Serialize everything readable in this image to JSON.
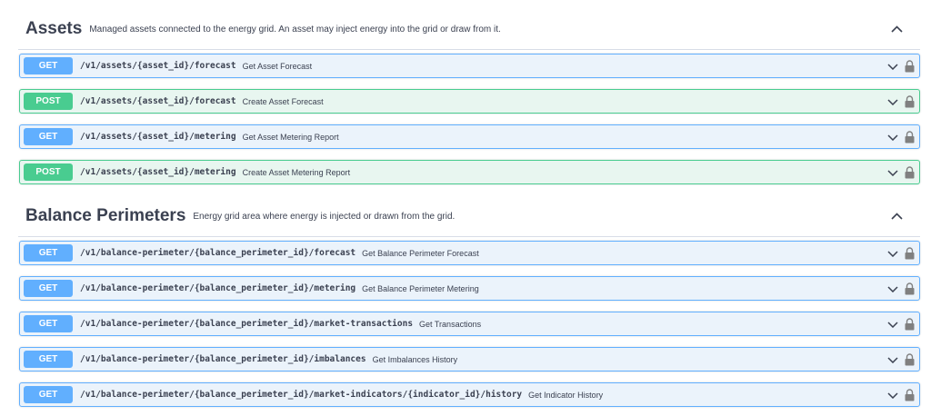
{
  "sections": [
    {
      "title": "Assets",
      "description": "Managed assets connected to the energy grid. An asset may inject energy into the grid or draw from it.",
      "operations": [
        {
          "method": "GET",
          "path": "/v1/assets/{asset_id}/forecast",
          "summary": "Get Asset Forecast"
        },
        {
          "method": "POST",
          "path": "/v1/assets/{asset_id}/forecast",
          "summary": "Create Asset Forecast"
        },
        {
          "method": "GET",
          "path": "/v1/assets/{asset_id}/metering",
          "summary": "Get Asset Metering Report"
        },
        {
          "method": "POST",
          "path": "/v1/assets/{asset_id}/metering",
          "summary": "Create Asset Metering Report"
        }
      ]
    },
    {
      "title": "Balance Perimeters",
      "description": "Energy grid area where energy is injected or drawn from the grid.",
      "operations": [
        {
          "method": "GET",
          "path": "/v1/balance-perimeter/{balance_perimeter_id}/forecast",
          "summary": "Get Balance Perimeter Forecast"
        },
        {
          "method": "GET",
          "path": "/v1/balance-perimeter/{balance_perimeter_id}/metering",
          "summary": "Get Balance Perimeter Metering"
        },
        {
          "method": "GET",
          "path": "/v1/balance-perimeter/{balance_perimeter_id}/market-transactions",
          "summary": "Get Transactions"
        },
        {
          "method": "GET",
          "path": "/v1/balance-perimeter/{balance_perimeter_id}/imbalances",
          "summary": "Get Imbalances History"
        },
        {
          "method": "GET",
          "path": "/v1/balance-perimeter/{balance_perimeter_id}/market-indicators/{indicator_id}/history",
          "summary": "Get Indicator History"
        }
      ]
    }
  ],
  "icons": {
    "section_toggle": "chevron-up-icon",
    "op_expand": "chevron-down-icon",
    "op_auth": "lock-icon"
  },
  "colors": {
    "get": "#61affe",
    "get_bg": "#ebf3fb",
    "post": "#49cc90",
    "post_bg": "#e8f6f0",
    "text": "#3b4151"
  }
}
